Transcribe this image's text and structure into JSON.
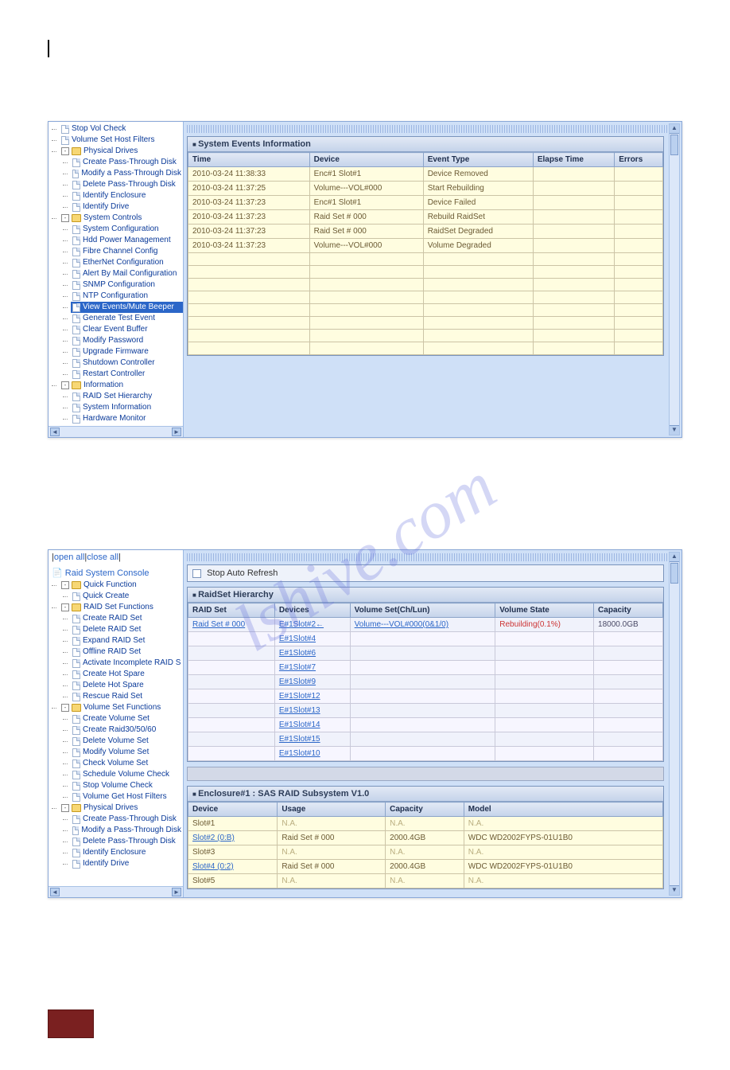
{
  "watermark": "lshive.com",
  "panel1": {
    "tree": [
      {
        "label": "Stop Vol Check",
        "icon": "page"
      },
      {
        "label": "Volume Set Host Filters",
        "icon": "page"
      },
      {
        "label": "Physical Drives",
        "icon": "folder",
        "expand": "-",
        "children": [
          {
            "label": "Create Pass-Through Disk",
            "icon": "page"
          },
          {
            "label": "Modify a Pass-Through Disk",
            "icon": "page"
          },
          {
            "label": "Delete Pass-Through Disk",
            "icon": "page"
          },
          {
            "label": "Identify Enclosure",
            "icon": "page"
          },
          {
            "label": "Identify Drive",
            "icon": "page"
          }
        ]
      },
      {
        "label": "System Controls",
        "icon": "folder",
        "expand": "-",
        "children": [
          {
            "label": "System Configuration",
            "icon": "page"
          },
          {
            "label": "Hdd Power Management",
            "icon": "page"
          },
          {
            "label": "Fibre Channel Config",
            "icon": "page"
          },
          {
            "label": "EtherNet Configuration",
            "icon": "page"
          },
          {
            "label": "Alert By Mail Configuration",
            "icon": "page"
          },
          {
            "label": "SNMP Configuration",
            "icon": "page"
          },
          {
            "label": "NTP Configuration",
            "icon": "page"
          },
          {
            "label": "View Events/Mute Beeper",
            "icon": "page",
            "selected": true
          },
          {
            "label": "Generate Test Event",
            "icon": "page"
          },
          {
            "label": "Clear Event Buffer",
            "icon": "page"
          },
          {
            "label": "Modify Password",
            "icon": "page"
          },
          {
            "label": "Upgrade Firmware",
            "icon": "page"
          },
          {
            "label": "Shutdown Controller",
            "icon": "page"
          },
          {
            "label": "Restart Controller",
            "icon": "page"
          }
        ]
      },
      {
        "label": "Information",
        "icon": "folder",
        "expand": "-",
        "children": [
          {
            "label": "RAID Set Hierarchy",
            "icon": "page"
          },
          {
            "label": "System Information",
            "icon": "page"
          },
          {
            "label": "Hardware Monitor",
            "icon": "page"
          }
        ]
      }
    ],
    "events": {
      "title": "System Events Information",
      "columns": [
        "Time",
        "Device",
        "Event Type",
        "Elapse Time",
        "Errors"
      ],
      "rows": [
        {
          "time": "2010-03-24 11:38:33",
          "device": "Enc#1 Slot#1",
          "event": "Device Removed",
          "elapse": "",
          "errors": ""
        },
        {
          "time": "2010-03-24 11:37:25",
          "device": "Volume---VOL#000",
          "event": "Start Rebuilding",
          "elapse": "",
          "errors": ""
        },
        {
          "time": "2010-03-24 11:37:23",
          "device": "Enc#1 Slot#1",
          "event": "Device Failed",
          "elapse": "",
          "errors": ""
        },
        {
          "time": "2010-03-24 11:37:23",
          "device": "Raid Set # 000",
          "event": "Rebuild RaidSet",
          "elapse": "",
          "errors": ""
        },
        {
          "time": "2010-03-24 11:37:23",
          "device": "Raid Set # 000",
          "event": "RaidSet Degraded",
          "elapse": "",
          "errors": ""
        },
        {
          "time": "2010-03-24 11:37:23",
          "device": "Volume---VOL#000",
          "event": "Volume Degraded",
          "elapse": "",
          "errors": ""
        }
      ],
      "empty_rows": 8
    }
  },
  "panel2": {
    "linkbar": {
      "open": "open all",
      "close": "close all"
    },
    "root": "Raid System Console",
    "tree": [
      {
        "label": "Quick Function",
        "icon": "folder",
        "expand": "-",
        "children": [
          {
            "label": "Quick Create",
            "icon": "page"
          }
        ]
      },
      {
        "label": "RAID Set Functions",
        "icon": "folder",
        "expand": "-",
        "children": [
          {
            "label": "Create RAID Set",
            "icon": "page"
          },
          {
            "label": "Delete RAID Set",
            "icon": "page"
          },
          {
            "label": "Expand RAID Set",
            "icon": "page"
          },
          {
            "label": "Offline RAID Set",
            "icon": "page"
          },
          {
            "label": "Activate Incomplete RAID S",
            "icon": "page"
          },
          {
            "label": "Create Hot Spare",
            "icon": "page"
          },
          {
            "label": "Delete Hot Spare",
            "icon": "page"
          },
          {
            "label": "Rescue Raid Set",
            "icon": "page"
          }
        ]
      },
      {
        "label": "Volume Set Functions",
        "icon": "folder",
        "expand": "-",
        "children": [
          {
            "label": "Create Volume Set",
            "icon": "page"
          },
          {
            "label": "Create Raid30/50/60",
            "icon": "page"
          },
          {
            "label": "Delete Volume Set",
            "icon": "page"
          },
          {
            "label": "Modify Volume Set",
            "icon": "page"
          },
          {
            "label": "Check Volume Set",
            "icon": "page"
          },
          {
            "label": "Schedule Volume Check",
            "icon": "page"
          },
          {
            "label": "Stop Volume Check",
            "icon": "page"
          },
          {
            "label": "Volume Get Host Filters",
            "icon": "page"
          }
        ]
      },
      {
        "label": "Physical Drives",
        "icon": "folder",
        "expand": "-",
        "children": [
          {
            "label": "Create Pass-Through Disk",
            "icon": "page"
          },
          {
            "label": "Modify a Pass-Through Disk",
            "icon": "page"
          },
          {
            "label": "Delete Pass-Through Disk",
            "icon": "page"
          },
          {
            "label": "Identify Enclosure",
            "icon": "page"
          },
          {
            "label": "Identify Drive",
            "icon": "page"
          }
        ]
      }
    ],
    "stop_refresh": "Stop Auto Refresh",
    "hierarchy": {
      "title": "RaidSet Hierarchy",
      "columns": [
        "RAID Set",
        "Devices",
        "Volume Set(Ch/Lun)",
        "Volume State",
        "Capacity"
      ],
      "rows": [
        {
          "raid": "Raid Set # 000",
          "dev": "E#1Slot#2←",
          "vol": "Volume---VOL#000(0&1/0)",
          "state": "Rebuilding(0.1%)",
          "cap": "18000.0GB"
        },
        {
          "raid": "",
          "dev": "E#1Slot#4",
          "vol": "",
          "state": "",
          "cap": ""
        },
        {
          "raid": "",
          "dev": "E#1Slot#6",
          "vol": "",
          "state": "",
          "cap": ""
        },
        {
          "raid": "",
          "dev": "E#1Slot#7",
          "vol": "",
          "state": "",
          "cap": ""
        },
        {
          "raid": "",
          "dev": "E#1Slot#9",
          "vol": "",
          "state": "",
          "cap": ""
        },
        {
          "raid": "",
          "dev": "E#1Slot#12",
          "vol": "",
          "state": "",
          "cap": ""
        },
        {
          "raid": "",
          "dev": "E#1Slot#13",
          "vol": "",
          "state": "",
          "cap": ""
        },
        {
          "raid": "",
          "dev": "E#1Slot#14",
          "vol": "",
          "state": "",
          "cap": ""
        },
        {
          "raid": "",
          "dev": "E#1Slot#15",
          "vol": "",
          "state": "",
          "cap": ""
        },
        {
          "raid": "",
          "dev": "E#1Slot#10",
          "vol": "",
          "state": "",
          "cap": ""
        }
      ]
    },
    "enclosure": {
      "title": "Enclosure#1 : SAS RAID Subsystem V1.0",
      "columns": [
        "Device",
        "Usage",
        "Capacity",
        "Model"
      ],
      "rows": [
        {
          "dev": "Slot#1",
          "usage": "N.A.",
          "cap": "N.A.",
          "model": "N.A.",
          "dim": true
        },
        {
          "dev": "Slot#2 (0:B)",
          "usage": "Raid Set # 000",
          "cap": "2000.4GB",
          "model": "WDC WD2002FYPS-01U1B0",
          "dim": false,
          "link": true
        },
        {
          "dev": "Slot#3",
          "usage": "N.A.",
          "cap": "N.A.",
          "model": "N.A.",
          "dim": true
        },
        {
          "dev": "Slot#4 (0:2)",
          "usage": "Raid Set # 000",
          "cap": "2000.4GB",
          "model": "WDC WD2002FYPS-01U1B0",
          "dim": false,
          "link": true
        },
        {
          "dev": "Slot#5",
          "usage": "N.A.",
          "cap": "N.A.",
          "model": "N.A.",
          "dim": true
        }
      ]
    }
  }
}
